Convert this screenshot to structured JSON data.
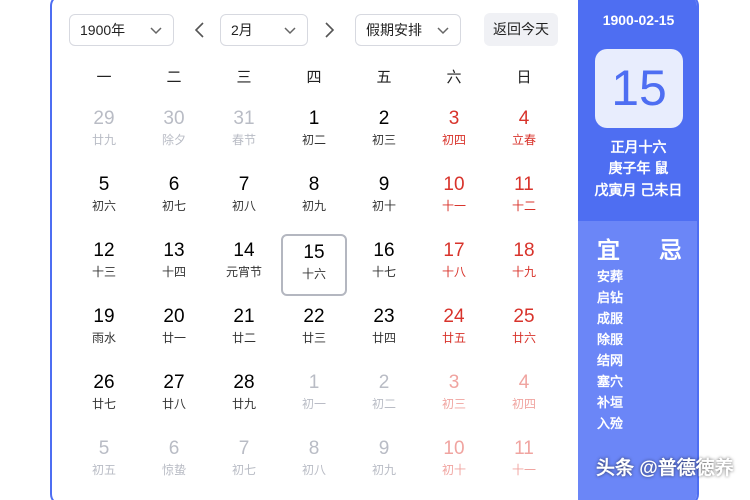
{
  "toolbar": {
    "year_select": "1900年",
    "month_select": "2月",
    "holiday_select": "假期安排",
    "today_button": "返回今天",
    "prev_icon": "chevron-left-icon",
    "next_icon": "chevron-right-icon"
  },
  "weekdays": [
    "一",
    "二",
    "三",
    "四",
    "五",
    "六",
    "日"
  ],
  "grid": {
    "rows": [
      [
        {
          "day": "29",
          "lunar": "廿九",
          "state": "other"
        },
        {
          "day": "30",
          "lunar": "除夕",
          "state": "other"
        },
        {
          "day": "31",
          "lunar": "春节",
          "state": "other"
        },
        {
          "day": "1",
          "lunar": "初二",
          "state": "normal"
        },
        {
          "day": "2",
          "lunar": "初三",
          "state": "normal"
        },
        {
          "day": "3",
          "lunar": "初四",
          "state": "weekend"
        },
        {
          "day": "4",
          "lunar": "立春",
          "state": "weekend"
        }
      ],
      [
        {
          "day": "5",
          "lunar": "初六",
          "state": "normal"
        },
        {
          "day": "6",
          "lunar": "初七",
          "state": "normal"
        },
        {
          "day": "7",
          "lunar": "初八",
          "state": "normal"
        },
        {
          "day": "8",
          "lunar": "初九",
          "state": "normal"
        },
        {
          "day": "9",
          "lunar": "初十",
          "state": "normal"
        },
        {
          "day": "10",
          "lunar": "十一",
          "state": "weekend"
        },
        {
          "day": "11",
          "lunar": "十二",
          "state": "weekend"
        }
      ],
      [
        {
          "day": "12",
          "lunar": "十三",
          "state": "normal"
        },
        {
          "day": "13",
          "lunar": "十四",
          "state": "normal"
        },
        {
          "day": "14",
          "lunar": "元宵节",
          "state": "normal"
        },
        {
          "day": "15",
          "lunar": "十六",
          "state": "selected"
        },
        {
          "day": "16",
          "lunar": "十七",
          "state": "normal"
        },
        {
          "day": "17",
          "lunar": "十八",
          "state": "weekend"
        },
        {
          "day": "18",
          "lunar": "十九",
          "state": "weekend"
        }
      ],
      [
        {
          "day": "19",
          "lunar": "雨水",
          "state": "normal"
        },
        {
          "day": "20",
          "lunar": "廿一",
          "state": "normal"
        },
        {
          "day": "21",
          "lunar": "廿二",
          "state": "normal"
        },
        {
          "day": "22",
          "lunar": "廿三",
          "state": "normal"
        },
        {
          "day": "23",
          "lunar": "廿四",
          "state": "normal"
        },
        {
          "day": "24",
          "lunar": "廿五",
          "state": "weekend"
        },
        {
          "day": "25",
          "lunar": "廿六",
          "state": "weekend"
        }
      ],
      [
        {
          "day": "26",
          "lunar": "廿七",
          "state": "normal"
        },
        {
          "day": "27",
          "lunar": "廿八",
          "state": "normal"
        },
        {
          "day": "28",
          "lunar": "廿九",
          "state": "normal"
        },
        {
          "day": "1",
          "lunar": "初一",
          "state": "other"
        },
        {
          "day": "2",
          "lunar": "初二",
          "state": "other"
        },
        {
          "day": "3",
          "lunar": "初三",
          "state": "other-weekend"
        },
        {
          "day": "4",
          "lunar": "初四",
          "state": "other-weekend"
        }
      ],
      [
        {
          "day": "5",
          "lunar": "初五",
          "state": "other"
        },
        {
          "day": "6",
          "lunar": "惊蛰",
          "state": "other"
        },
        {
          "day": "7",
          "lunar": "初七",
          "state": "other"
        },
        {
          "day": "8",
          "lunar": "初八",
          "state": "other"
        },
        {
          "day": "9",
          "lunar": "初九",
          "state": "other"
        },
        {
          "day": "10",
          "lunar": "初十",
          "state": "other-weekend"
        },
        {
          "day": "11",
          "lunar": "十一",
          "state": "other-weekend"
        }
      ]
    ]
  },
  "sidebar": {
    "date": "1900-02-15",
    "big_day": "15",
    "lunar_date": "正月十六",
    "year_ganzhi": "庚子年 鼠",
    "month_day_ganzhi": "戊寅月 己未日",
    "yi_label": "宜",
    "ji_label": "忌",
    "yi_items": [
      "安葬",
      "启钻",
      "成服",
      "除服",
      "结网",
      "塞穴",
      "补垣",
      "入殓"
    ]
  },
  "watermark": "头条 @普德徳养",
  "colors": {
    "accent": "#4e6ef2",
    "accent_light": "#6b86f7",
    "weekend_red": "#d8332b",
    "muted_gray": "#b9bcc5"
  }
}
